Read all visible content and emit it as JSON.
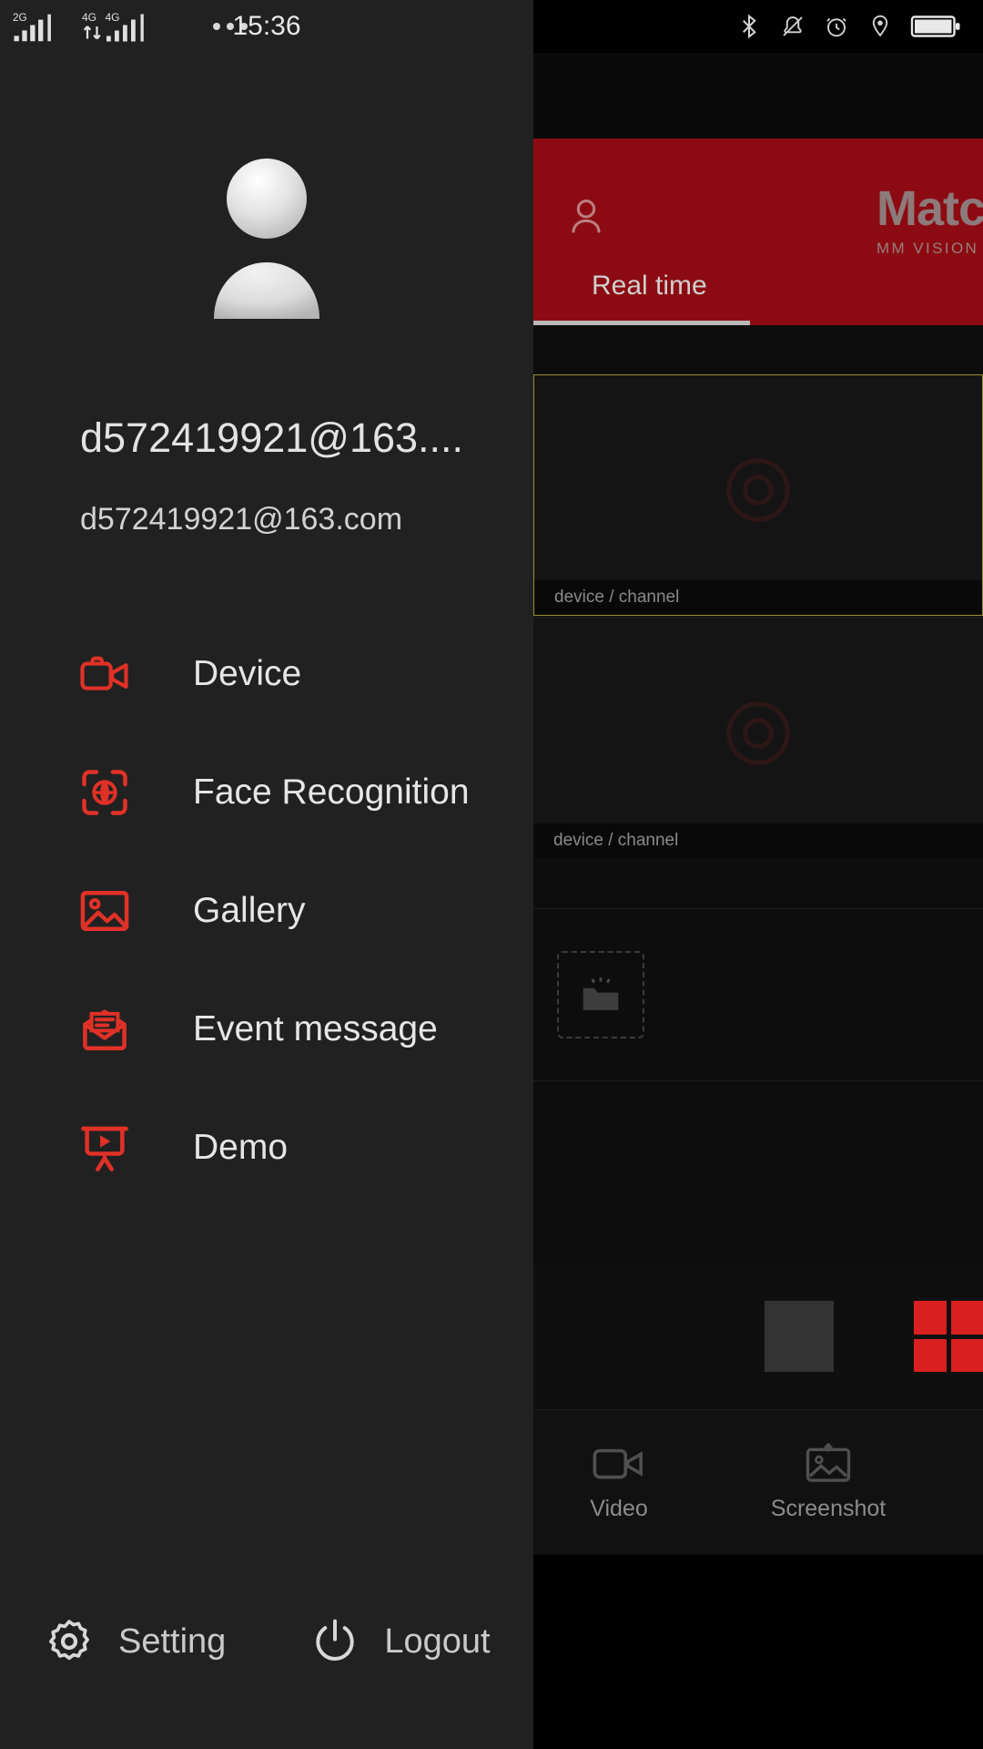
{
  "status_bar": {
    "carrier_left": "2G",
    "carrier_right_1": "4G",
    "carrier_right_2": "4G",
    "overflow": "…",
    "time": "15:36",
    "right_icons": [
      "bluetooth-icon",
      "bell-muted-icon",
      "alarm-clock-icon",
      "location-pin-icon",
      "battery-icon"
    ]
  },
  "drawer": {
    "avatar_name": "avatar",
    "user_name": "d572419921@163....",
    "user_email": "d572419921@163.com",
    "menu": [
      {
        "label": "Device",
        "icon": "video-camera-icon"
      },
      {
        "label": "Face Recognition",
        "icon": "face-scan-icon"
      },
      {
        "label": "Gallery",
        "icon": "image-icon"
      },
      {
        "label": "Event message",
        "icon": "envelope-icon"
      },
      {
        "label": "Demo",
        "icon": "presentation-play-icon"
      }
    ],
    "footer": {
      "setting_label": "Setting",
      "setting_icon": "gear-icon",
      "logout_label": "Logout",
      "logout_icon": "power-icon"
    }
  },
  "app": {
    "brand_name": "Matc",
    "brand_sub": "MM VISION",
    "header_user_icon": "person-outline-icon",
    "tab_label": "Real time",
    "video_cells": [
      {
        "caption": "device / channel"
      },
      {
        "caption": "device / channel"
      }
    ],
    "empty_slot_icon": "folder-open-icon",
    "layout_buttons": [
      "layout-single-icon",
      "layout-quad-icon"
    ],
    "tools": [
      {
        "label": "Video",
        "icon": "video-record-icon"
      },
      {
        "label": "Screenshot",
        "icon": "screenshot-icon"
      }
    ]
  },
  "colors": {
    "accent_red": "#e03127",
    "header_red": "#8c0b12",
    "drawer_bg": "#212121",
    "selected_border": "#9a9030"
  }
}
